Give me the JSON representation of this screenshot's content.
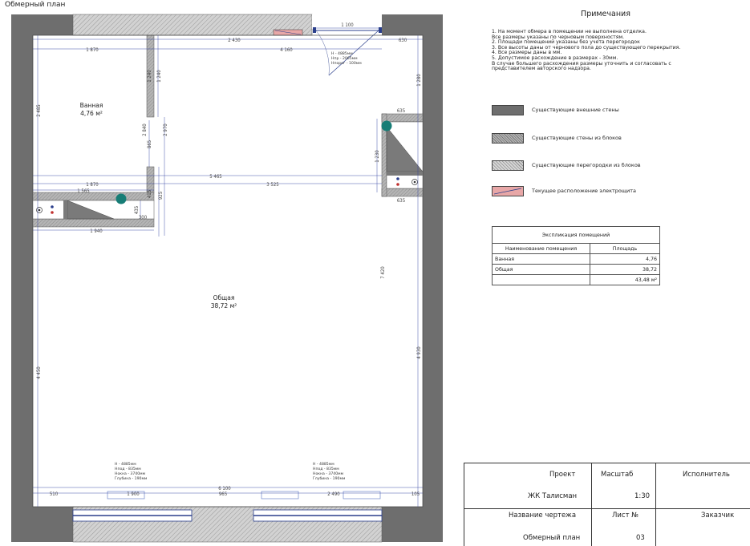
{
  "page": {
    "title": "Обмерный план"
  },
  "colors": {
    "external_wall": "#6e6e6e",
    "block_wall": "#b9b9b9",
    "partition": "#cfcfcf",
    "panel": "#e8a7a7",
    "wire": "#2b3f8c",
    "teal_marker": "#177d76",
    "dim_line": "#2f3ea0"
  },
  "notes": {
    "title": "Примечания",
    "items": [
      "1. На момент обмера в помещении не выполнена отделка.",
      "Все размеры указаны по черновым поверхностям.",
      "2. Площади помещений указаны без учета перегородок",
      "3. Все высоты даны от чернового пола до существующего перекрытия.",
      "4. Все размеры даны в мм.",
      "5. Допустимое расхождение в размерах - 30мм.",
      "В случае большего расхождения размеры уточнить и согласовать с",
      "представителем авторского надзора."
    ]
  },
  "legend": [
    {
      "label": "Существующие внешние стены",
      "icon": "external-wall-swatch"
    },
    {
      "label": "Существующие стены из блоков",
      "icon": "block-wall-swatch"
    },
    {
      "label": "Существующие перегородки из блоков",
      "icon": "partition-swatch"
    },
    {
      "label": "Текущее расположение электрощита",
      "icon": "electrical-panel-swatch"
    }
  ],
  "explication": {
    "caption": "Экспликация помещений",
    "headers": [
      "Наименование помещения",
      "Площадь"
    ],
    "rows": [
      {
        "name": "Ванная",
        "area": "4,76"
      },
      {
        "name": "Общая",
        "area": "38,72"
      },
      {
        "name": "",
        "area": "43,48 м²"
      }
    ]
  },
  "title_block": {
    "project_label": "Проект",
    "project_value": "ЖК Талисман",
    "scale_label": "Масштаб",
    "scale_value": "1:30",
    "executor_label": "Исполнитель",
    "drawing_label": "Название чертежа",
    "drawing_value": "Обмерный план",
    "sheet_label": "Лист №",
    "sheet_value": "03",
    "customer_label": "Заказчик"
  },
  "rooms": {
    "bath": {
      "name": "Ванная",
      "area": "4,76 м²"
    },
    "common": {
      "name": "Общая",
      "area": "38,72 м²"
    }
  },
  "heights": {
    "door": [
      "H - 4885мм",
      "Hпр - 2065мм",
      "Hпорог - 100мм"
    ],
    "window_left": [
      "H - 4885мм",
      "Hпод - 835мм",
      "Hокна - 3740мм",
      "Глубина - 190мм"
    ],
    "window_right": [
      "H - 4885мм",
      "Hпод - 835мм",
      "Hокна - 3740мм",
      "Глубина - 190мм"
    ]
  },
  "dimensions": {
    "top_door": "1 100",
    "top_2430": "2 430",
    "top_630": "630",
    "top_1870": "1 870",
    "top_4160": "4 160",
    "left_2485": "2 485",
    "left_4450": "4 450",
    "left_1240a": "1 240",
    "left_1240b": "1 240",
    "mid_2840": "2 840",
    "mid_2970": "2 970",
    "mid_865": "865",
    "mid_415": "415",
    "mid_925": "925",
    "mid_435": "435",
    "mid_300": "300",
    "mid_1870": "1 870",
    "mid_1565": "1 565",
    "mid_1940": "1 940",
    "mid_5465": "5 465",
    "mid_3525": "3 525",
    "right_1280": "1 280",
    "right_635a": "635",
    "right_635b": "635",
    "right_1230": "1 230",
    "right_7420": "7 420",
    "right_4930": "4 930",
    "bottom_510": "510",
    "bottom_1900": "1 900",
    "bottom_965": "965",
    "bottom_6100": "6 100",
    "bottom_2490": "2 490",
    "bottom_105": "105"
  }
}
